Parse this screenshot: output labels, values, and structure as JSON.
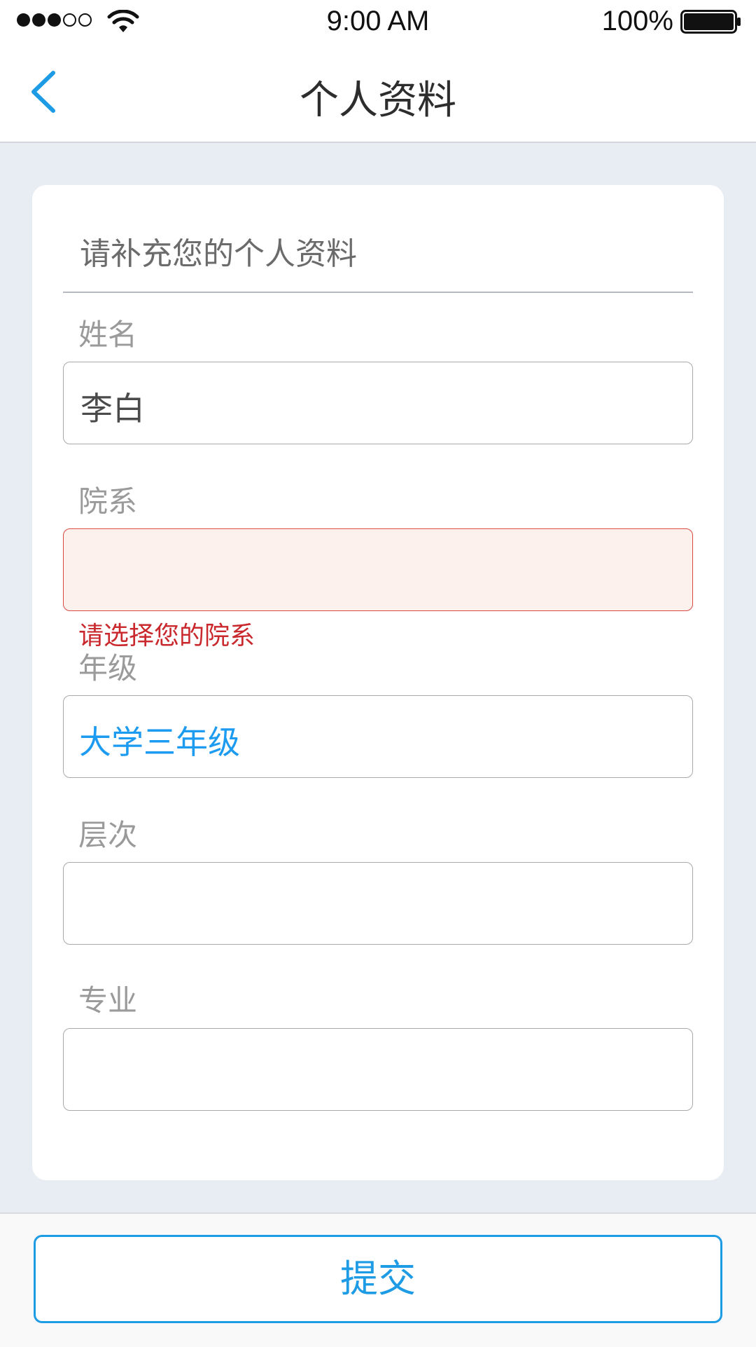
{
  "status_bar": {
    "time": "9:00 AM",
    "battery_percent": "100%",
    "signal_bars_filled": 3,
    "signal_bars_total": 5,
    "icons": [
      "signal-icon",
      "wifi-icon",
      "battery-icon"
    ]
  },
  "nav": {
    "title": "个人资料",
    "back_icon": "chevron-left-icon"
  },
  "form": {
    "header": "请补充您的个人资料",
    "fields": [
      {
        "label": "姓名",
        "value": "李白",
        "state": "normal"
      },
      {
        "label": "院系",
        "value": "",
        "state": "error",
        "error": "请选择您的院系"
      },
      {
        "label": "年级",
        "value": "大学三年级",
        "state": "selected"
      },
      {
        "label": "层次",
        "value": "",
        "state": "normal"
      },
      {
        "label": "专业",
        "value": "",
        "state": "normal"
      }
    ]
  },
  "submit": {
    "label": "提交"
  },
  "colors": {
    "accent": "#1e9be5",
    "error": "#c9282d",
    "error_bg": "#fdf1ee",
    "page_bg": "#e8ecf3"
  }
}
